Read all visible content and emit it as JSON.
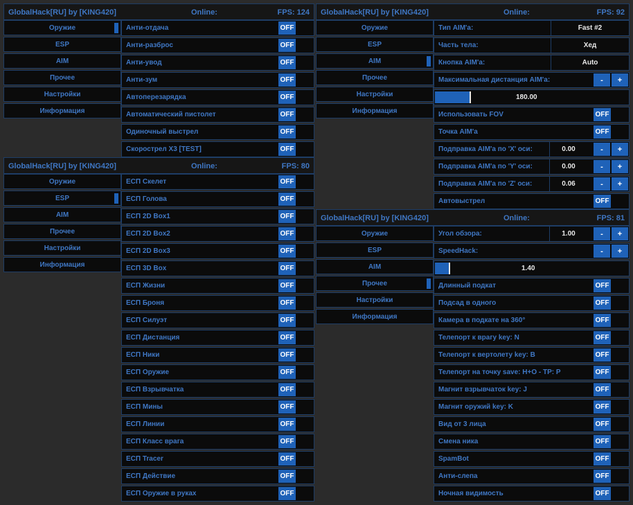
{
  "accent": "#1f62b8",
  "text_color": "#3f77c4",
  "nav_labels": [
    "Оружие",
    "ESP",
    "AIM",
    "Прочее",
    "Настройки",
    "Информация"
  ],
  "off_label": "OFF",
  "minus_label": "-",
  "plus_label": "+",
  "panels": {
    "weapons": {
      "title": "GlobalHack[RU] by [KING420]",
      "online": "Online:",
      "fps": "FPS: 124",
      "active_nav": "Оружие",
      "options": [
        "Анти-отдача",
        "Анти-разброс",
        "Анти-увод",
        "Анти-зум",
        "Автоперезарядка",
        "Автоматический пистолет",
        "Одиночный выстрел",
        "Скорострел X3 [TEST]"
      ]
    },
    "esp": {
      "title": "GlobalHack[RU] by [KING420]",
      "online": "Online:",
      "fps": "FPS: 80",
      "active_nav": "ESP",
      "options": [
        "ЕСП Скелет",
        "ЕСП Голова",
        "ЕСП 2D Box1",
        "ЕСП 2D Box2",
        "ЕСП 2D Box3",
        "ЕСП 3D Box",
        "ЕСП Жизни",
        "ЕСП Броня",
        "ЕСП Силуэт",
        "ЕСП Дистанция",
        "ЕСП Ники",
        "ЕСП Оружие",
        "ЕСП Взрывчатка",
        "ЕСП Мины",
        "ЕСП Линии",
        "ЕСП Класс врага",
        "ЕСП Tracer",
        "ЕСП Действие",
        "ЕСП Оружие в руках"
      ]
    },
    "aim": {
      "title": "GlobalHack[RU] by [KING420]",
      "online": "Online:",
      "fps": "FPS: 92",
      "active_nav": "AIM",
      "aim_type": {
        "label": "Тип AIM'a:",
        "value": "Fast #2"
      },
      "body_part": {
        "label": "Часть тела:",
        "value": "Хед"
      },
      "aim_key": {
        "label": "Кнопка AIM'a:",
        "value": "Auto"
      },
      "max_distance": {
        "label": "Максимальная дистанция AIM'a:",
        "value": "180.00",
        "fraction": 0.18
      },
      "use_fov": "Использовать FOV",
      "aim_point": "Точка AIM'a",
      "corr_x": {
        "label": "Подправка AIM'a по 'X' оси:",
        "value": "0.00"
      },
      "corr_y": {
        "label": "Подправка AIM'a по 'Y' оси:",
        "value": "0.00"
      },
      "corr_z": {
        "label": "Подправка AIM'a по 'Z' оси:",
        "value": "0.06"
      },
      "autoshot": "Автовыстрел"
    },
    "misc": {
      "title": "GlobalHack[RU] by [KING420]",
      "online": "Online:",
      "fps": "FPS: 81",
      "active_nav": "Прочее",
      "fov_angle": {
        "label": "Угол обзора:",
        "value": "1.00"
      },
      "speedhack": {
        "label": "SpeedHack:",
        "value": "1.40",
        "fraction": 0.07
      },
      "options": [
        "Длинный подкат",
        "Подсад в одного",
        "Камера в подкате на 360°",
        "Телепорт к врагу key: N",
        "Телепорт к вертолету key: B",
        "Телепорт на точку save: H+O - TP: P",
        "Магнит взрывчаток key: J",
        "Магнит оружий key: K",
        "Вид от 3 лица",
        "Смена ника",
        "SpamBot",
        "Анти-слепа",
        "Ночная видимость"
      ]
    }
  }
}
